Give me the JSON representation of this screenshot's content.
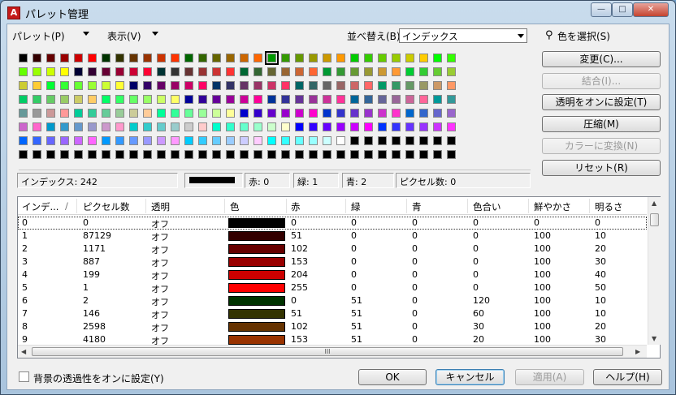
{
  "window": {
    "title": "パレット管理",
    "minimize": "—",
    "maximize": "□",
    "close": "✕",
    "app_icon": "A"
  },
  "menubar": {
    "palette": "パレット(P)",
    "view": "表示(V)",
    "sort_label": "並べ替え(B):",
    "sort_value": "インデックス",
    "pick_color": "色を選択(S)"
  },
  "side_buttons": {
    "change": "変更(C)...",
    "merge": "結合(I)...",
    "transparency": "透明をオンに設定(T)",
    "compress": "圧縮(M)",
    "convert": "カラーに変換(N)",
    "reset": "リセット(R)"
  },
  "info": {
    "index": "インデックス:  242",
    "red": "赤: 0",
    "green": "緑: 1",
    "blue": "青: 2",
    "pixels": "ピクセル数: 0",
    "swatch_color": "#000000"
  },
  "palette_grid": [
    [
      "#000000",
      "#330000",
      "#660000",
      "#990000",
      "#cc0000",
      "#ff0000",
      "#003300",
      "#333300",
      "#663300",
      "#993300",
      "#cc3300",
      "#ff3300",
      "#006600",
      "#336600",
      "#666600",
      "#996600",
      "#cc6600",
      "#ff6600",
      "#009900",
      "#339900",
      "#669900",
      "#999900",
      "#cc9900",
      "#ff9900",
      "#00cc00",
      "#33cc00",
      "#66cc00",
      "#99cc00",
      "#cccc00",
      "#ffcc00",
      "#00ff00",
      "#33ff00"
    ],
    [
      "#66ff00",
      "#99ff00",
      "#ccff00",
      "#ffff00",
      "#000033",
      "#330033",
      "#660033",
      "#990033",
      "#cc0033",
      "#ff0033",
      "#003333",
      "#333333",
      "#663333",
      "#993333",
      "#cc3333",
      "#ff3333",
      "#006633",
      "#336633",
      "#666633",
      "#996633",
      "#cc6633",
      "#ff6633",
      "#009933",
      "#339933",
      "#669933",
      "#999933",
      "#cc9933",
      "#ff9933",
      "#00cc33",
      "#33cc33",
      "#66cc33",
      "#99cc33"
    ],
    [
      "#cccc33",
      "#ffcc33",
      "#00ff33",
      "#33ff33",
      "#66ff33",
      "#99ff33",
      "#ccff33",
      "#ffff33",
      "#000066",
      "#330066",
      "#660066",
      "#990066",
      "#cc0066",
      "#ff0066",
      "#003366",
      "#333366",
      "#663366",
      "#993366",
      "#cc3366",
      "#ff3366",
      "#006666",
      "#336666",
      "#666666",
      "#996666",
      "#cc6666",
      "#ff6666",
      "#009966",
      "#339966",
      "#669966",
      "#999966",
      "#cc9966",
      "#ff9966"
    ],
    [
      "#00cc66",
      "#33cc66",
      "#66cc66",
      "#99cc66",
      "#cccc66",
      "#ffcc66",
      "#00ff66",
      "#33ff66",
      "#66ff66",
      "#99ff66",
      "#ccff66",
      "#ffff66",
      "#000099",
      "#330099",
      "#660099",
      "#990099",
      "#cc0099",
      "#ff0099",
      "#003399",
      "#333399",
      "#663399",
      "#993399",
      "#cc3399",
      "#ff3399",
      "#006699",
      "#336699",
      "#666699",
      "#996699",
      "#cc6699",
      "#ff6699",
      "#009999",
      "#339999"
    ],
    [
      "#669999",
      "#999999",
      "#cc9999",
      "#ff9999",
      "#00cc99",
      "#33cc99",
      "#66cc99",
      "#99cc99",
      "#cccc99",
      "#ffcc99",
      "#00ff99",
      "#33ff99",
      "#66ff99",
      "#99ff99",
      "#ccff99",
      "#ffff99",
      "#0000cc",
      "#3300cc",
      "#6600cc",
      "#9900cc",
      "#cc00cc",
      "#ff00cc",
      "#0033cc",
      "#3333cc",
      "#6633cc",
      "#9933cc",
      "#cc33cc",
      "#ff33cc",
      "#0066cc",
      "#3366cc",
      "#6666cc",
      "#9966cc"
    ],
    [
      "#cc66cc",
      "#ff66cc",
      "#0099cc",
      "#3399cc",
      "#6699cc",
      "#9999cc",
      "#cc99cc",
      "#ff99cc",
      "#00cccc",
      "#33cccc",
      "#66cccc",
      "#99cccc",
      "#cccccc",
      "#ffcccc",
      "#00ffcc",
      "#33ffcc",
      "#66ffcc",
      "#99ffcc",
      "#ccffcc",
      "#ffffcc",
      "#0000ff",
      "#3300ff",
      "#6600ff",
      "#9900ff",
      "#cc00ff",
      "#ff00ff",
      "#0033ff",
      "#3333ff",
      "#6633ff",
      "#9933ff",
      "#cc33ff",
      "#ff33ff"
    ],
    [
      "#0066ff",
      "#3366ff",
      "#6666ff",
      "#9966ff",
      "#cc66ff",
      "#ff66ff",
      "#0099ff",
      "#3399ff",
      "#6699ff",
      "#9999ff",
      "#cc99ff",
      "#ff99ff",
      "#00ccff",
      "#33ccff",
      "#66ccff",
      "#99ccff",
      "#ccccff",
      "#ffccff",
      "#00ffff",
      "#33ffff",
      "#66ffff",
      "#99ffff",
      "#ccffff",
      "#ffffff",
      "#000000",
      "#000000",
      "#000000",
      "#000000",
      "#000000",
      "#000000",
      "#000000",
      "#000000"
    ],
    [
      "#000000",
      "#000000",
      "#000000",
      "#000000",
      "#000000",
      "#000000",
      "#000000",
      "#000000",
      "#000000",
      "#000000",
      "#000000",
      "#000000",
      "#000000",
      "#000000",
      "#000000",
      "#000000",
      "#000000",
      "#000000",
      "#000000",
      "#000000",
      "#000000",
      "#000000",
      "#000000",
      "#000000",
      "#000000",
      "#000000",
      "#000000",
      "#000000",
      "#000000",
      "#000000",
      "#000000",
      "#000000"
    ]
  ],
  "selected_cell": {
    "row": 0,
    "col": 18
  },
  "table": {
    "headers": [
      "インデ...",
      "ピクセル数",
      "透明",
      "色",
      "赤",
      "緑",
      "青",
      "色合い",
      "鮮やかさ",
      "明るさ"
    ],
    "sort_indicator": "/",
    "rows": [
      {
        "i": "0",
        "px": "0",
        "t": "オフ",
        "color": "#000000",
        "r": "0",
        "g": "0",
        "b": "0",
        "h": "0",
        "s": "0",
        "l": "0"
      },
      {
        "i": "1",
        "px": "87129",
        "t": "オフ",
        "color": "#330000",
        "r": "51",
        "g": "0",
        "b": "0",
        "h": "0",
        "s": "100",
        "l": "10"
      },
      {
        "i": "2",
        "px": "1171",
        "t": "オフ",
        "color": "#660000",
        "r": "102",
        "g": "0",
        "b": "0",
        "h": "0",
        "s": "100",
        "l": "20"
      },
      {
        "i": "3",
        "px": "887",
        "t": "オフ",
        "color": "#990000",
        "r": "153",
        "g": "0",
        "b": "0",
        "h": "0",
        "s": "100",
        "l": "30"
      },
      {
        "i": "4",
        "px": "199",
        "t": "オフ",
        "color": "#cc0000",
        "r": "204",
        "g": "0",
        "b": "0",
        "h": "0",
        "s": "100",
        "l": "40"
      },
      {
        "i": "5",
        "px": "1",
        "t": "オフ",
        "color": "#ff0000",
        "r": "255",
        "g": "0",
        "b": "0",
        "h": "0",
        "s": "100",
        "l": "50"
      },
      {
        "i": "6",
        "px": "2",
        "t": "オフ",
        "color": "#003300",
        "r": "0",
        "g": "51",
        "b": "0",
        "h": "120",
        "s": "100",
        "l": "10"
      },
      {
        "i": "7",
        "px": "146",
        "t": "オフ",
        "color": "#333300",
        "r": "51",
        "g": "51",
        "b": "0",
        "h": "60",
        "s": "100",
        "l": "10"
      },
      {
        "i": "8",
        "px": "2598",
        "t": "オフ",
        "color": "#663300",
        "r": "102",
        "g": "51",
        "b": "0",
        "h": "30",
        "s": "100",
        "l": "20"
      },
      {
        "i": "9",
        "px": "4180",
        "t": "オフ",
        "color": "#993300",
        "r": "153",
        "g": "51",
        "b": "0",
        "h": "20",
        "s": "100",
        "l": "30"
      }
    ],
    "hscroll_grip": "III"
  },
  "footer": {
    "bg_transparency": "背景の透過性をオンに設定(Y)",
    "ok": "OK",
    "cancel": "キャンセル",
    "apply": "適用(A)",
    "help": "ヘルプ(H)"
  }
}
